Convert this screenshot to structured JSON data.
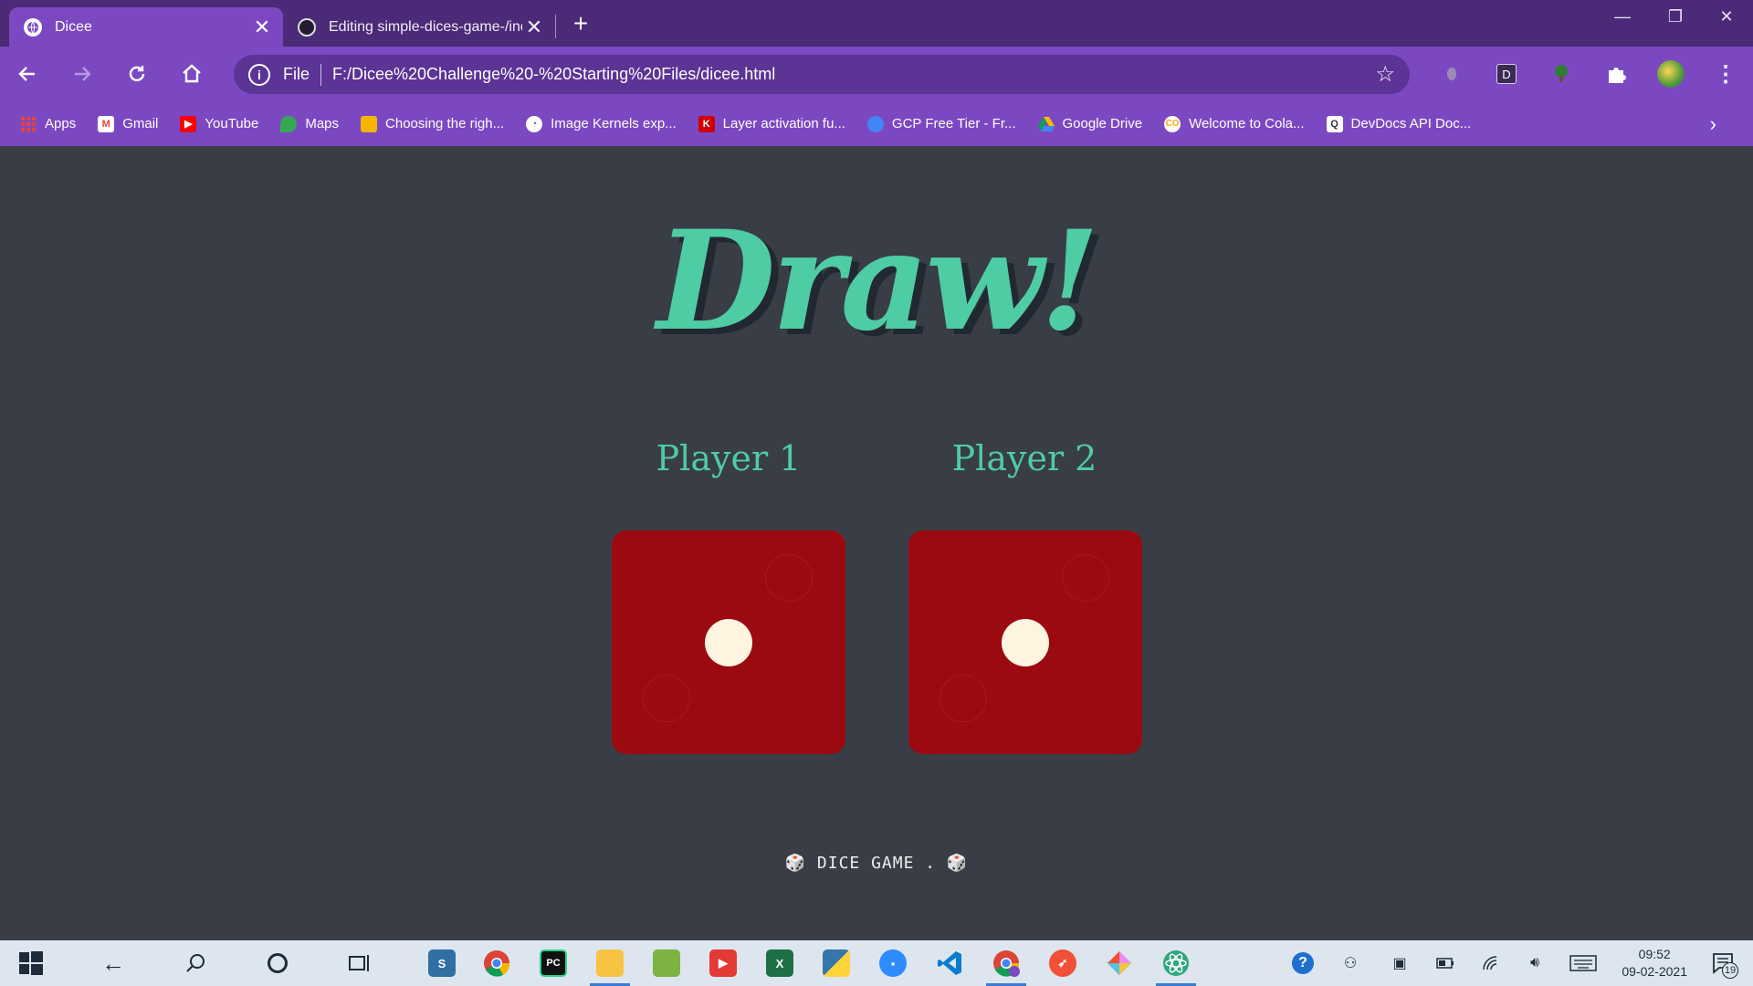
{
  "browser": {
    "tabs": [
      {
        "label": "Dicee",
        "active": true,
        "icon": "globe-icon"
      },
      {
        "label": "Editing simple-dices-game-/index.html",
        "active": false,
        "icon": "github-icon"
      }
    ],
    "address": {
      "scheme_label": "File",
      "url": "F:/Dicee%20Challenge%20-%20Starting%20Files/dicee.html"
    },
    "extensions": [
      "ext-gray-icon",
      "D",
      "tree-icon",
      "puzzle-icon",
      "avatar"
    ],
    "bookmarks": [
      {
        "label": "Apps",
        "icon": "apps-grid-icon",
        "color": "#e94335"
      },
      {
        "label": "Gmail",
        "icon": "gmail-icon",
        "color": "#e94335"
      },
      {
        "label": "YouTube",
        "icon": "youtube-icon",
        "color": "#ff0000"
      },
      {
        "label": "Maps",
        "icon": "maps-icon",
        "color": "#34a853"
      },
      {
        "label": "Choosing the righ...",
        "icon": "article-icon",
        "color": "#f4b400"
      },
      {
        "label": "Image Kernels exp...",
        "icon": "kernel-icon",
        "color": "#ffffff"
      },
      {
        "label": "Layer activation fu...",
        "icon": "k-icon",
        "color": "#d00000"
      },
      {
        "label": "GCP Free Tier - Fr...",
        "icon": "gcp-icon",
        "color": "#4285f4"
      },
      {
        "label": "Google Drive",
        "icon": "drive-icon",
        "color": "#0f9d58"
      },
      {
        "label": "Welcome to Cola...",
        "icon": "colab-icon",
        "color": "#f9ab00"
      },
      {
        "label": "DevDocs API Doc...",
        "icon": "devdocs-icon",
        "color": "#ffffff"
      }
    ]
  },
  "page": {
    "heading": "Draw!",
    "players": [
      {
        "label": "Player 1",
        "dice_value": 1
      },
      {
        "label": "Player 2",
        "dice_value": 1
      }
    ],
    "footer": "🎲 DICE GAME . 🎲"
  },
  "colors": {
    "background": "#393e46",
    "accent": "#4ecca3",
    "die": "#9b0a10",
    "pip": "#fff4e0",
    "browser_frame": "#7c48c2"
  },
  "taskbar": {
    "apps": [
      "start-icon",
      "back-icon",
      "search-icon",
      "cortana-icon",
      "task-view-icon",
      "sublime-icon",
      "chrome-icon",
      "pycharm-icon",
      "file-explorer-icon",
      "notepad-icon",
      "media-player-icon",
      "excel-icon",
      "python-icon",
      "zoom-icon",
      "vscode-icon",
      "chrome-profile-icon",
      "swift-icon",
      "git-icon",
      "atom-icon"
    ],
    "time": "09:52",
    "date": "09-02-2021",
    "notification_count": "19"
  }
}
